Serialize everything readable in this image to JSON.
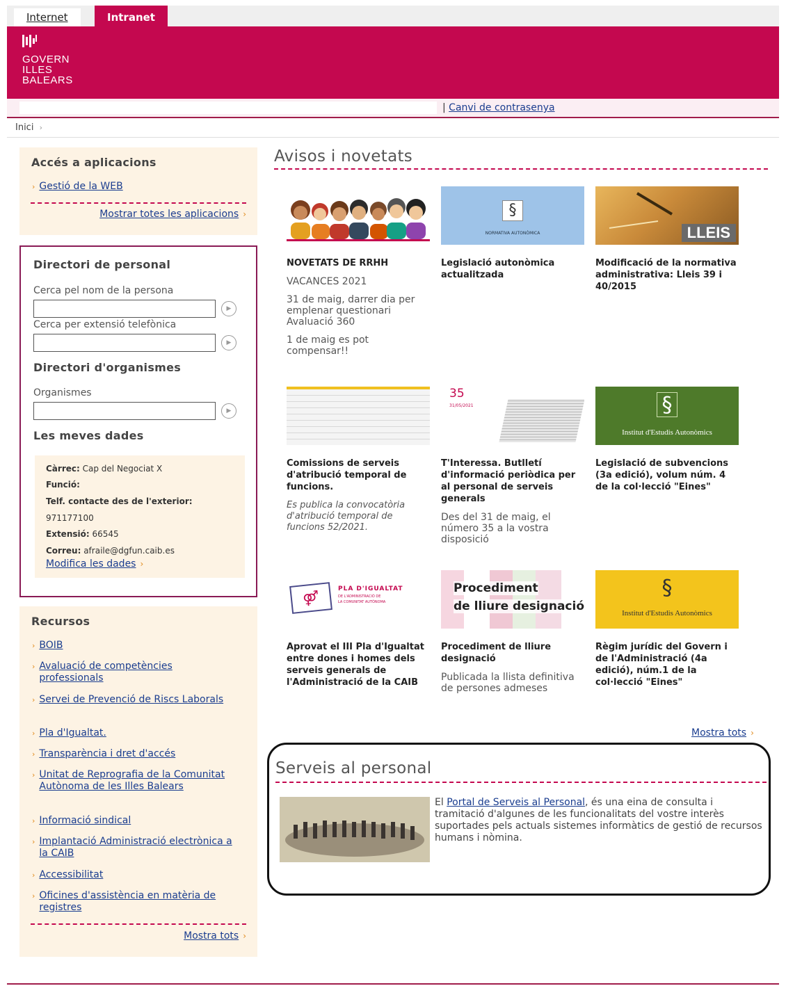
{
  "tabs": {
    "internet": "Internet",
    "intranet": "Intranet"
  },
  "logo": {
    "line1": "GOVERN",
    "line2": "ILLES",
    "line3": "BALEARS"
  },
  "userbar": {
    "change_password": "Canvi de contrasenya",
    "separator": "|"
  },
  "breadcrumb": {
    "home": "Inici",
    "sep": "›"
  },
  "apps": {
    "title": "Accés a aplicacions",
    "items": [
      "Gestió de la WEB"
    ],
    "more": "Mostrar totes les aplicacions"
  },
  "directory": {
    "title": "Directori de personal",
    "search_name_label": "Cerca pel nom de la persona",
    "search_ext_label": "Cerca per extensió telefònica",
    "org_title": "Directori d'organismes",
    "org_label": "Organismes",
    "mydata_title": "Les meves dades",
    "mydata": {
      "carrec_label": "Càrrec:",
      "carrec": "Cap del Negociat X",
      "funcio_label": "Funció:",
      "telf_label": "Telf. contacte des de l'exterior:",
      "telf": "971177100",
      "ext_label": "Extensió:",
      "ext": "66545",
      "correu_label": "Correu:",
      "correu": "afraile@dgfun.caib.es",
      "edit": "Modifica les dades"
    }
  },
  "resources": {
    "title": "Recursos",
    "items": [
      "BOIB",
      "Avaluació de competències professionals",
      "Servei de Prevenció de Riscs Laborals",
      "Pla d'Igualtat.",
      "Transparència i dret d'accés",
      "Unitat de Reprografia de la Comunitat Autònoma de les Illes Balears",
      "Informació sindical",
      "Implantació Administració electrònica a la CAIB",
      "Accessibilitat",
      "Oficines d'assistència en matèria de registres"
    ],
    "more": "Mostra tots"
  },
  "news": {
    "title": "Avisos i novetats",
    "cards": [
      {
        "title": "NOVETATS DE RRHH",
        "lines": [
          "VACANCES 2021",
          "31 de maig, darrer dia per emplenar questionari Avaluació 360",
          "1 de maig es pot compensar!!"
        ]
      },
      {
        "title": "Legislació autonòmica actualitzada",
        "img_text": "NORMATIVA AUTONÒMICA",
        "icon": "§"
      },
      {
        "title": "Modificació de la normativa administrativa: Lleis 39 i 40/2015",
        "img_text": "LLEIS"
      },
      {
        "title": "Comissions de serveis d'atribució temporal de funcions.",
        "text": "Es publica la convocatòria d'atribució temporal de funcions 52/2021."
      },
      {
        "title": "T'Interessa. Butlletí d'informació periòdica per al personal de serveis generals",
        "img_num": "35",
        "img_date": "31/05/2021",
        "text": "Des del 31 de maig, el número 35 a la vostra disposició"
      },
      {
        "title": "Legislació de subvencions (3a edició), volum núm. 4 de la col·lecció \"Eines\"",
        "img_text": "Institut d'Estudis Autonòmics",
        "icon": "§"
      },
      {
        "title": "Aprovat el III Pla d'Igualtat entre dones i homes dels serveis generals de l'Administració de la CAIB",
        "img_line1": "PLA D'IGUALTAT",
        "img_line2": "DE L'ADMINISTRACIÓ DE",
        "img_line3": "LA COMUNITAT AUTÒNOMA"
      },
      {
        "title": "Procediment de lliure designació",
        "img_line1": "Procediment",
        "img_line2": "de lliure designació",
        "text": "Publicada la llista definitiva de persones admeses"
      },
      {
        "title": "Règim jurídic del Govern i de l'Administració (4a edició), núm.1 de la col·lecció \"Eines\"",
        "img_text": "Institut d'Estudis Autonòmics",
        "icon": "§"
      }
    ],
    "more": "Mostra tots"
  },
  "services": {
    "title": "Serveis al personal",
    "text_pre": "El ",
    "link": "Portal de Serveis al Personal",
    "text_post": ", és una eina de consulta i tramitació d'algunes de les funcionalitats del vostre interès suportades pels actuals sistemes informàtics de gestió de recursos humans i nòmina."
  },
  "colors": {
    "brand": "#c4084f",
    "sidebar_bg": "#fdf3e4",
    "link": "#1a3d8f",
    "accent": "#e08a1c"
  }
}
